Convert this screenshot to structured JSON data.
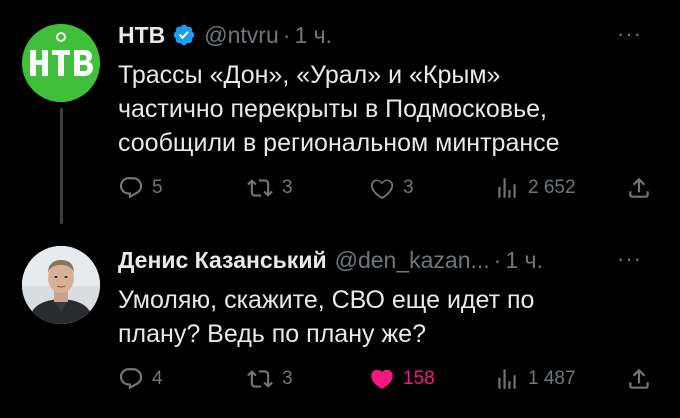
{
  "tweets": [
    {
      "author_name": "НТВ",
      "handle": "@ntvru",
      "separator": "·",
      "time": "1 ч.",
      "more": "···",
      "text_lines": [
        "Трассы «Дон», «Урал» и «Крым»",
        "частично перекрыты в Подмосковье,",
        "сообщили в региональном минтрансе"
      ],
      "replies": "5",
      "retweets": "3",
      "likes": "3",
      "views": "2 652",
      "logo_text": "НТВ"
    },
    {
      "author_name": "Денис Казанський",
      "handle": "@den_kazan...",
      "separator": "·",
      "time": "1 ч.",
      "more": "···",
      "text_lines": [
        "Умоляю, скажите, СВО еще идет по",
        "плану? Ведь по плану же?"
      ],
      "replies": "4",
      "retweets": "3",
      "likes": "158",
      "views": "1 487"
    }
  ],
  "colors": {
    "background": "#000000",
    "text": "#e7e9ea",
    "secondary": "#71767b",
    "verified": "#1d9bf0",
    "like_active": "#f91880",
    "ntv_green": "#3fbf3a"
  },
  "icons": [
    "verified-badge-icon",
    "reply-icon",
    "retweet-icon",
    "like-icon",
    "views-icon",
    "share-icon",
    "more-icon"
  ]
}
